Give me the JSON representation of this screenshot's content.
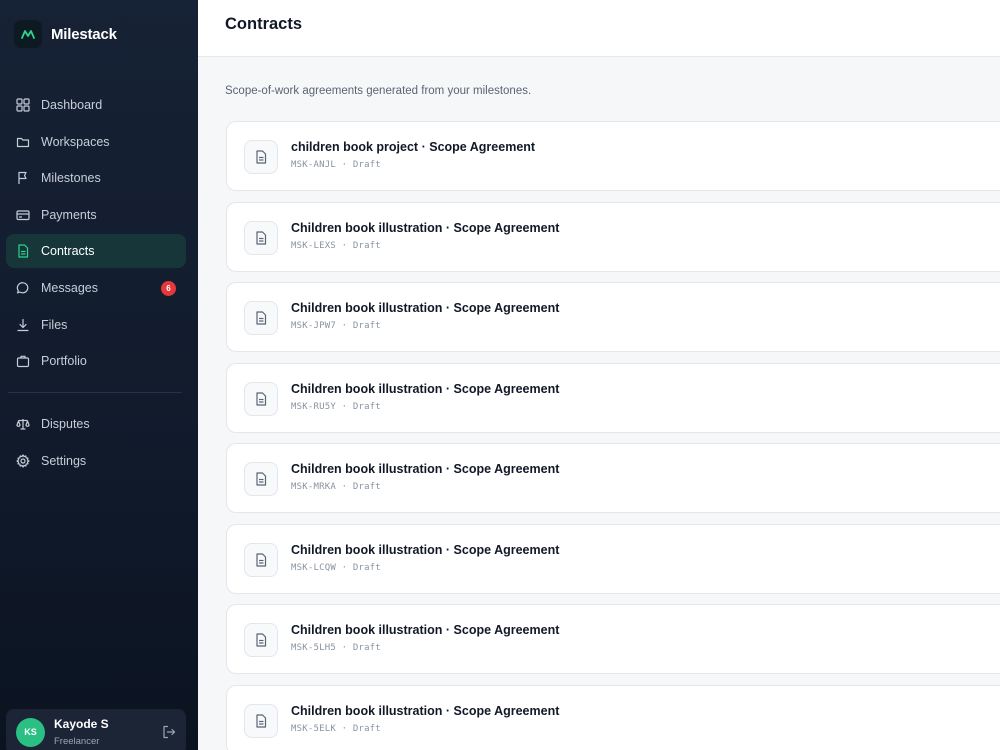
{
  "app": {
    "name": "Milestack"
  },
  "sidebar": {
    "items": [
      {
        "label": "Dashboard",
        "icon": "dashboard-icon"
      },
      {
        "label": "Workspaces",
        "icon": "folder-icon"
      },
      {
        "label": "Milestones",
        "icon": "flag-icon"
      },
      {
        "label": "Payments",
        "icon": "credit-card-icon"
      },
      {
        "label": "Contracts",
        "icon": "document-icon",
        "active": true
      },
      {
        "label": "Messages",
        "icon": "chat-icon",
        "badge": "6"
      },
      {
        "label": "Files",
        "icon": "download-icon"
      },
      {
        "label": "Portfolio",
        "icon": "briefcase-icon"
      }
    ],
    "secondary": [
      {
        "label": "Disputes",
        "icon": "scale-icon"
      },
      {
        "label": "Settings",
        "icon": "gear-icon"
      }
    ]
  },
  "user": {
    "initials": "KS",
    "name": "Kayode S",
    "role": "Freelancer"
  },
  "header": {
    "title": "Contracts"
  },
  "main": {
    "subtitle": "Scope-of-work agreements generated from your milestones.",
    "separator": "·",
    "contracts": [
      {
        "project": "children book project",
        "type": "Scope Agreement",
        "id": "MSK-ANJL",
        "status": "Draft"
      },
      {
        "project": "Children book illustration",
        "type": "Scope Agreement",
        "id": "MSK-LEXS",
        "status": "Draft"
      },
      {
        "project": "Children book illustration",
        "type": "Scope Agreement",
        "id": "MSK-JPW7",
        "status": "Draft"
      },
      {
        "project": "Children book illustration",
        "type": "Scope Agreement",
        "id": "MSK-RU5Y",
        "status": "Draft"
      },
      {
        "project": "Children book illustration",
        "type": "Scope Agreement",
        "id": "MSK-MRKA",
        "status": "Draft"
      },
      {
        "project": "Children book illustration",
        "type": "Scope Agreement",
        "id": "MSK-LCQW",
        "status": "Draft"
      },
      {
        "project": "Children book illustration",
        "type": "Scope Agreement",
        "id": "MSK-5LH5",
        "status": "Draft"
      },
      {
        "project": "Children book illustration",
        "type": "Scope Agreement",
        "id": "MSK-5ELK",
        "status": "Draft"
      }
    ]
  },
  "colors": {
    "accent": "#2fd38f",
    "sidebar_bg": "#111b2c",
    "active_bg": "#16363a",
    "badge": "#e5383b"
  }
}
